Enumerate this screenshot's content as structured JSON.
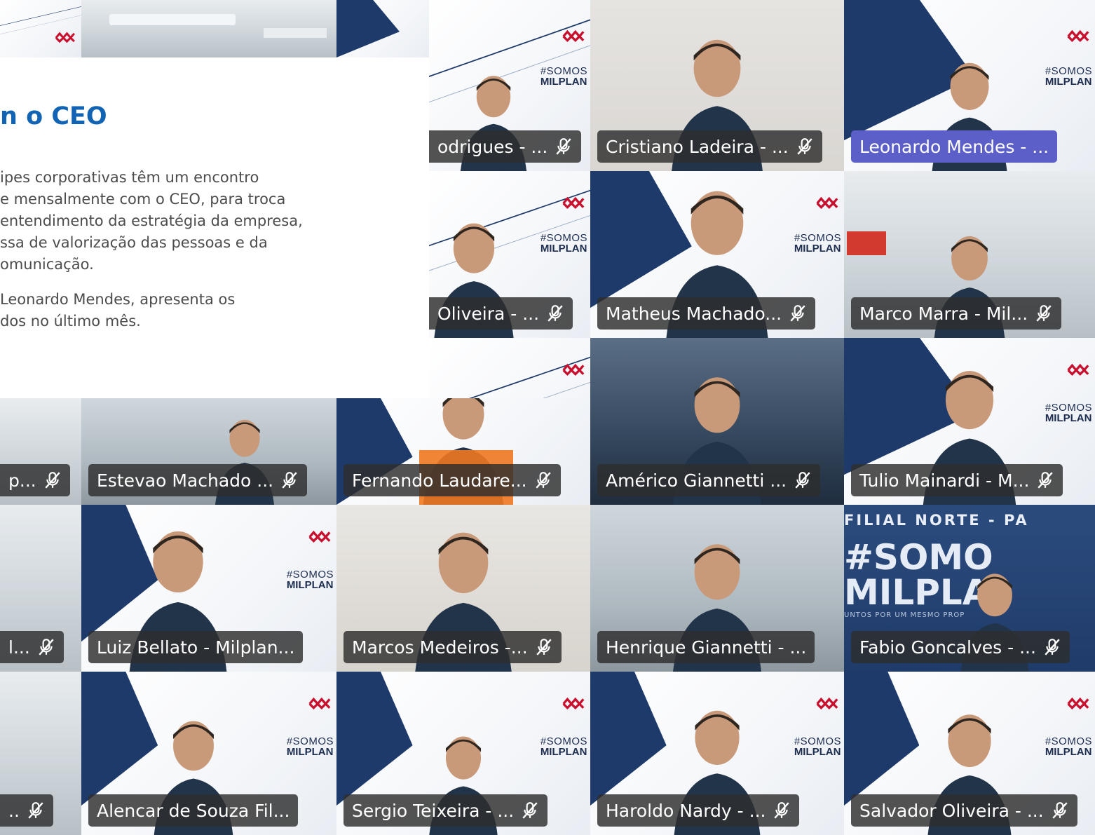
{
  "article": {
    "headline": "n o CEO",
    "paragraph1": [
      "ipes corporativas têm um encontro",
      "e mensalmente com o CEO, para troca",
      "entendimento da estratégia da empresa,",
      "ssa de valorização das pessoas e da",
      "omunicação."
    ],
    "paragraph2": [
      " Leonardo Mendes, apresenta os",
      "dos no último mês."
    ]
  },
  "brand": {
    "hashtag_top": "#SOMOS",
    "hashtag_bottom": "MILPLAN",
    "logo_text": "MILPLAN",
    "colors": {
      "navy": "#1d3a6b",
      "accent_red": "#c8102e",
      "headline_blue": "#1164b4",
      "teams_purple": "#5b5fc7"
    }
  },
  "filial": {
    "banner": "FILIAL NORTE - PA",
    "big_line1": "#SOMO",
    "big_line2": "MILPLA",
    "sub": "UNTOS POR UM MESMO PROP"
  },
  "participants": {
    "p01": "odrigues - ...",
    "p02": "Cristiano Ladeira - ...",
    "p03": "Leonardo Mendes - ...",
    "p04": "Oliveira - ...",
    "p05": "Matheus Machado...",
    "p06": "Marco Marra - Mil...",
    "p07": "p...",
    "p08": "Estevao Machado ...",
    "p09": "Fernando Laudare...",
    "p10": "Américo Giannetti ...",
    "p11": "Tulio Mainardi - M...",
    "p12": "l...",
    "p13": "Luiz Bellato - Milplan...",
    "p14": "Marcos Medeiros -...",
    "p15": "Henrique Giannetti - ...",
    "p16": "Fabio Goncalves - ...",
    "p17": "..",
    "p18": "Alencar de Souza Fil...",
    "p19": "Sergio Teixeira - ...",
    "p20": "Haroldo Nardy - ...",
    "p21": "Salvador Oliveira - ..."
  },
  "icons": {
    "mic_off": "mic-off-icon",
    "logo": "milplan-logo-icon"
  }
}
